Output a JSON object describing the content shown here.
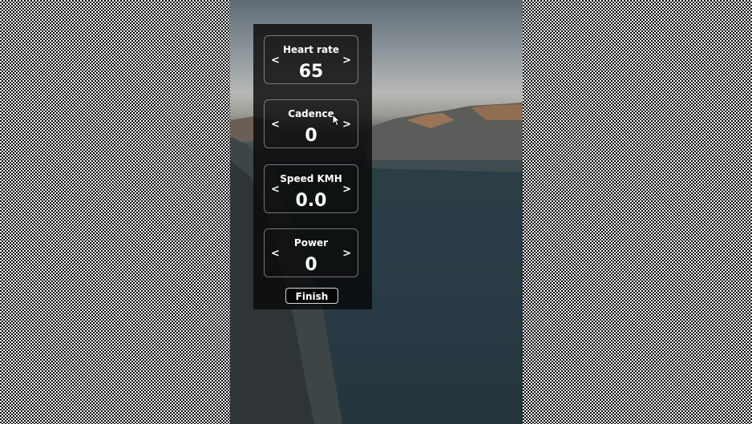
{
  "metrics": [
    {
      "label": "Heart rate",
      "value": "65",
      "dec_icon": "<",
      "inc_icon": ">"
    },
    {
      "label": "Cadence",
      "value": "0",
      "dec_icon": "<",
      "inc_icon": ">"
    },
    {
      "label": "Speed KMH",
      "value": "0.0",
      "dec_icon": "<",
      "inc_icon": ">"
    },
    {
      "label": "Power",
      "value": "0",
      "dec_icon": "<",
      "inc_icon": ">"
    }
  ],
  "finish_label": "Finish",
  "colors": {
    "panel_bg": "#080808",
    "text": "#ffffff",
    "border": "#c8c8c8"
  }
}
